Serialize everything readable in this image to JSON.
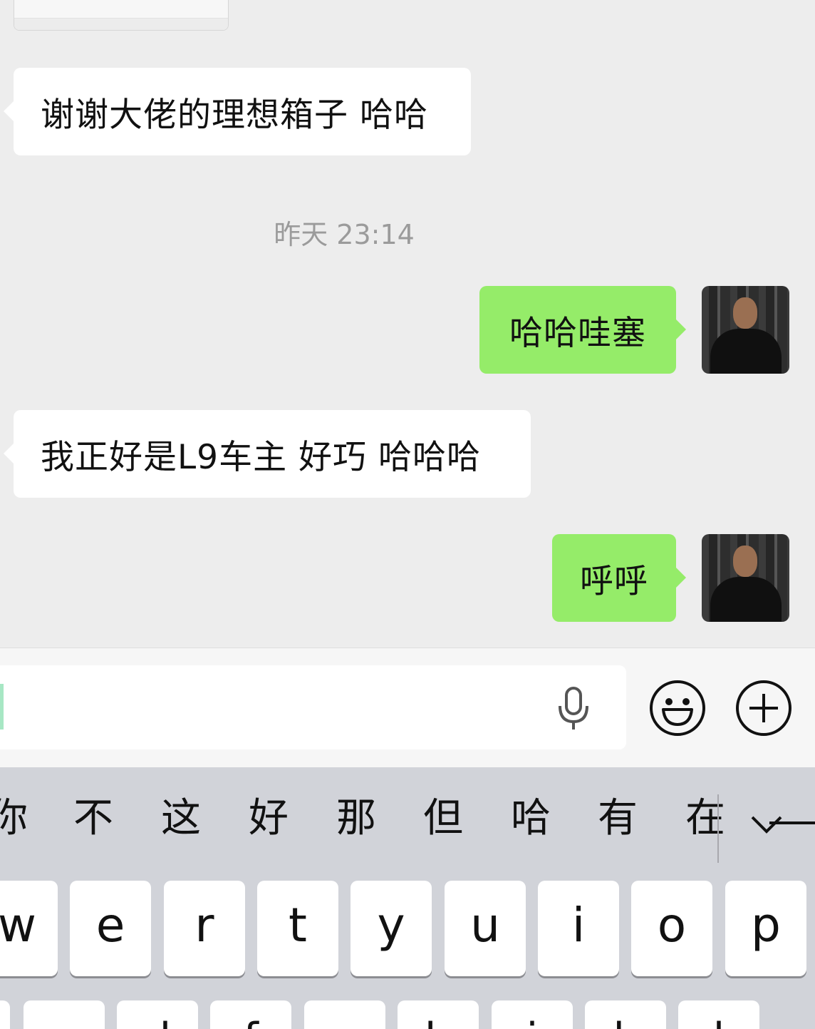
{
  "chat": {
    "messages": [
      {
        "side": "in",
        "text": "谢谢大佬的理想箱子 哈哈"
      },
      {
        "side": "out",
        "text": "哈哈哇塞"
      },
      {
        "side": "in",
        "text": "我正好是L9车主 好巧 哈哈哈"
      },
      {
        "side": "out",
        "text": "呼呼"
      }
    ],
    "timestamp": "昨天 23:14"
  },
  "input": {
    "value": "",
    "icons": {
      "voice": "microphone-icon",
      "emoji": "emoji-icon",
      "more": "plus-icon"
    }
  },
  "keyboard": {
    "candidates": [
      "你",
      "不",
      "这",
      "好",
      "那",
      "但",
      "哈",
      "有",
      "在"
    ],
    "row1_keys": [
      "w",
      "e",
      "r",
      "t",
      "y",
      "u",
      "i",
      "o",
      "p"
    ],
    "row2_keys": [
      "",
      "",
      "d",
      "f",
      "",
      "h",
      "j",
      "k",
      "l"
    ],
    "collapse_icon": "collapse-candidates-icon"
  }
}
